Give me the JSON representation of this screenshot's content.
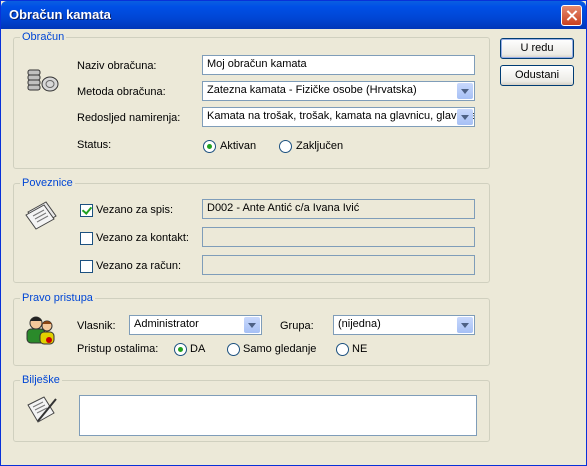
{
  "window": {
    "title": "Obračun kamata"
  },
  "buttons": {
    "ok": "U redu",
    "cancel": "Odustani"
  },
  "obracun": {
    "legend": "Obračun",
    "naziv_label": "Naziv obračuna:",
    "naziv_value": "Moj obračun kamata",
    "metoda_label": "Metoda obračuna:",
    "metoda_value": "Zatezna kamata - Fizičke osobe (Hrvatska)",
    "redoslijed_label": "Redosljed namirenja:",
    "redoslijed_value": "Kamata na trošak, trošak, kamata na glavnicu, glavnica",
    "status_label": "Status:",
    "status_options": [
      "Aktivan",
      "Zaključen"
    ],
    "status_selected": "Aktivan"
  },
  "poveznice": {
    "legend": "Poveznice",
    "spis_label": "Vezano za spis:",
    "spis_checked": true,
    "spis_value": "D002 - Ante Antić c/a Ivana Ivić",
    "kontakt_label": "Vezano za kontakt:",
    "kontakt_checked": false,
    "kontakt_value": "",
    "racun_label": "Vezano za račun:",
    "racun_checked": false,
    "racun_value": ""
  },
  "pravo": {
    "legend": "Pravo pristupa",
    "vlasnik_label": "Vlasnik:",
    "vlasnik_value": "Administrator",
    "grupa_label": "Grupa:",
    "grupa_value": "(nijedna)",
    "pristup_label": "Pristup ostalima:",
    "pristup_options": [
      "DA",
      "Samo gledanje",
      "NE"
    ],
    "pristup_selected": "DA"
  },
  "biljeske": {
    "legend": "Bilješke",
    "value": ""
  },
  "colors": {
    "titlebar": "#0050e6",
    "legend": "#0046d5",
    "checkmark": "#21a121"
  },
  "icons": [
    "coins-icon",
    "documents-icon",
    "users-icon",
    "notes-icon",
    "close-icon",
    "chevron-down-icon"
  ]
}
